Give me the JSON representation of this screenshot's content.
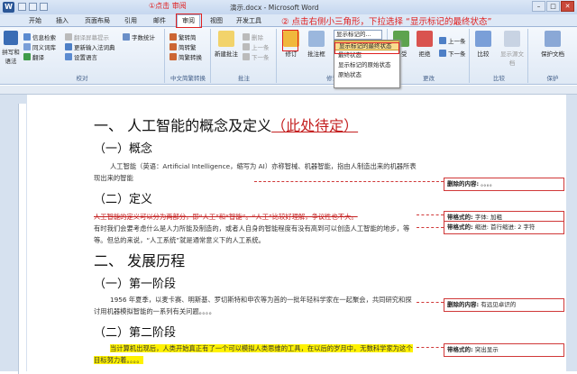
{
  "title": {
    "doc": "演示.docx - Microsoft Word"
  },
  "tabs": [
    "开始",
    "插入",
    "页面布局",
    "引用",
    "邮件",
    "审阅",
    "视图",
    "开发工具"
  ],
  "ribbon": {
    "proofing": {
      "spell": "拼写和语法",
      "info": "信息检索",
      "thesaurus": "同义词库",
      "translate": "翻译",
      "translate_tip": "翻译屏幕提示",
      "update_ime": "更新输入法词典",
      "lang": "设置语言",
      "wordcount": "字数统计",
      "label": "校对"
    },
    "chinese": {
      "s2t": "繁转简",
      "t2s": "简转繁",
      "conv": "简繁转换",
      "label": "中文简繁转换"
    },
    "comment": {
      "new": "新建批注",
      "del": "删除",
      "prev": "上一条",
      "next": "下一条",
      "label": "批注"
    },
    "track": {
      "track": "修订",
      "balloon": "批注框",
      "label": "修订"
    },
    "changes": {
      "accept": "接受",
      "reject": "拒绝",
      "prev": "上一条",
      "next": "下一条",
      "label": "更改"
    },
    "compare": {
      "compare": "比较",
      "show_source": "显示源文档",
      "label": "比较"
    },
    "protect": {
      "protect": "保护文档",
      "label": "保护"
    }
  },
  "dropdown": {
    "value": "显示标记的..."
  },
  "menu": [
    "显示标记的最终状态",
    "最终状态",
    "显示标记的原始状态",
    "原始状态"
  ],
  "annotations": {
    "a1": "①点击 审阅",
    "a2": "② 点击右侧小三角形，下拉选择 “显示标记的最终状态”"
  },
  "doc": {
    "h1a_text": "一、  人工智能的概念及定义",
    "h1a_pending": "（此处待定）",
    "h2a": "（一）概念",
    "p1": "人工智能（英语：Artificial Intelligence，缩写为 AI）亦称智械、机器智能，指由人制造出来的机器所表现出来的智能",
    "h2b": "（二）定义",
    "p2a": "人工智能的定义可以分为两部分，即“人工”和“智能”。“人工”比较好理解，争议性也不大。",
    "p2b": "有时我们会要考虑什么是人力所能及制造的，或者人自身的智能程度有没有高到可以创造人工智能的地步，等等。但总的来说，“人工系统”就是通常意义下的人工系统。",
    "h1b": "二、  发展历程",
    "h2c": "（一）第一阶段",
    "p3": "1956 年夏季，以麦卡赛、明斯基、罗切斯特和申农等为首的一批年轻科学家在一起聚会，共同研究和探讨用机器模拟智能的一系列有关问题。。。。",
    "h2d": "（二）第二阶段",
    "p4": "当计算机出现后，人类开始真正有了一个可以模拟人类思维的工具，在以后的岁月中，无数科学家为这个目标努力着。。。。"
  },
  "balloons": [
    {
      "label": "删除的内容:",
      "text": "。。。。"
    },
    {
      "label": "带格式的:",
      "text": "字体: 加粗"
    },
    {
      "label": "带格式的:",
      "text": "缩进: 首行缩进: 2 字符"
    },
    {
      "label": "删除的内容:",
      "text": "有远见卓识的"
    },
    {
      "label": "带格式的:",
      "text": "突出显示"
    }
  ]
}
